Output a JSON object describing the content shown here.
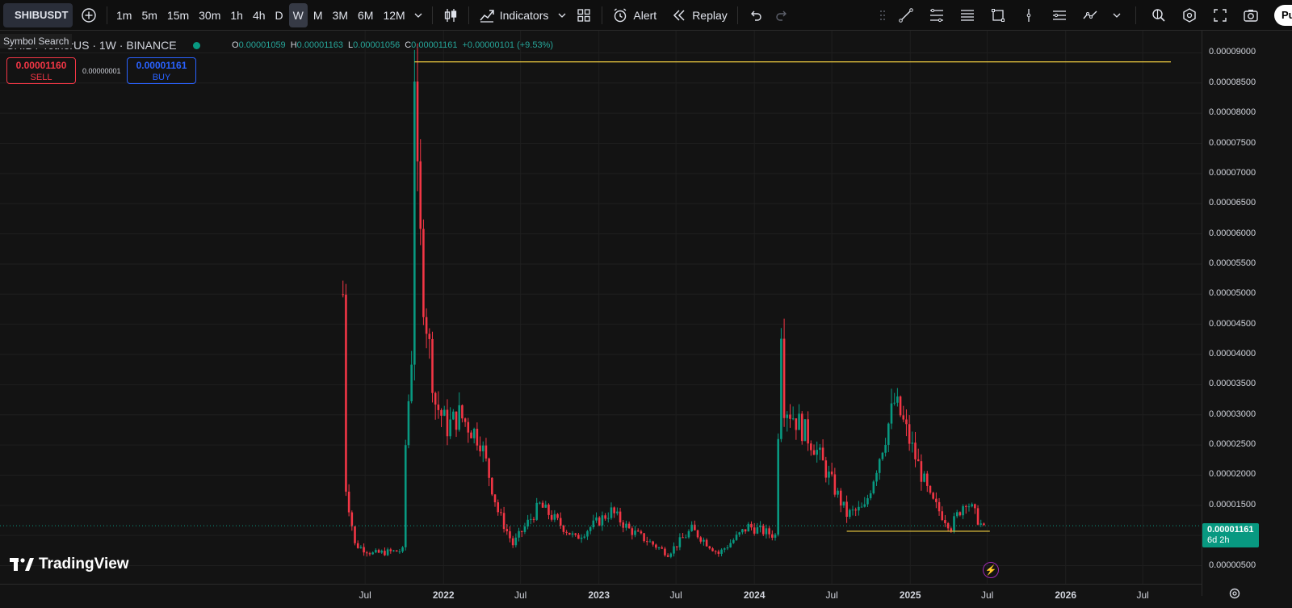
{
  "toolbar": {
    "symbol": "SHIBUSDT",
    "timeframes": [
      "1m",
      "5m",
      "15m",
      "30m",
      "1h",
      "4h",
      "D",
      "W",
      "M",
      "3M",
      "6M",
      "12M"
    ],
    "active_timeframe": "W",
    "indicators_label": "Indicators",
    "alert_label": "Alert",
    "replay_label": "Replay",
    "publish_label": "Pu"
  },
  "tooltip": "Symbol Search",
  "legend": {
    "title": "SHIB / TetherUS · 1W · BINANCE",
    "o_key": "O",
    "o_val": "0.00001059",
    "h_key": "H",
    "h_val": "0.00001163",
    "l_key": "L",
    "l_val": "0.00001056",
    "c_key": "C",
    "c_val": "0.00001161",
    "change": "+0.00000101 (+9.53%)"
  },
  "trade": {
    "sell_price": "0.00001160",
    "sell_label": "SELL",
    "spread": "0.00000001",
    "buy_price": "0.00001161",
    "buy_label": "BUY"
  },
  "price_axis": {
    "ticks": [
      "0.00009000",
      "0.00008500",
      "0.00008000",
      "0.00007500",
      "0.00007000",
      "0.00006500",
      "0.00006000",
      "0.00005500",
      "0.00005000",
      "0.00004500",
      "0.00004000",
      "0.00003500",
      "0.00003000",
      "0.00002500",
      "0.00002000",
      "0.00001500",
      "0.00001000",
      "0.00000500"
    ],
    "current_price": "0.00001161",
    "countdown": "6d 2h"
  },
  "time_axis": {
    "labels": [
      {
        "text": "Jul",
        "year": false
      },
      {
        "text": "2022",
        "year": true
      },
      {
        "text": "Jul",
        "year": false
      },
      {
        "text": "2023",
        "year": true
      },
      {
        "text": "Jul",
        "year": false
      },
      {
        "text": "2024",
        "year": true
      },
      {
        "text": "Jul",
        "year": false
      },
      {
        "text": "2025",
        "year": true
      },
      {
        "text": "Jul",
        "year": false
      },
      {
        "text": "2026",
        "year": true
      },
      {
        "text": "Jul",
        "year": false
      }
    ]
  },
  "logo_text": "TradingView",
  "colors": {
    "up": "#089981",
    "down": "#f23645",
    "hline": "#f5d142",
    "background": "#131313"
  },
  "chart_data": {
    "type": "candlestick",
    "symbol": "SHIBUSDT",
    "interval": "1W",
    "ylim": [
      4e-06,
      9.18e-05
    ],
    "x_range": [
      "2021-05",
      "2026-11"
    ],
    "horizontal_lines": [
      8.85e-05,
      1.07e-05
    ],
    "current_price": 1.161e-05,
    "path_points": [
      {
        "date": "2021-05-10",
        "value": 5e-05
      },
      {
        "date": "2021-05-17",
        "value": 1.8e-05
      },
      {
        "date": "2021-06-07",
        "value": 8.5e-06
      },
      {
        "date": "2021-07-19",
        "value": 7e-06
      },
      {
        "date": "2021-09-27",
        "value": 7.5e-06
      },
      {
        "date": "2021-10-04",
        "value": 2.5e-05
      },
      {
        "date": "2021-10-18",
        "value": 4e-05
      },
      {
        "date": "2021-10-25",
        "value": 8.85e-05
      },
      {
        "date": "2021-11-01",
        "value": 6.7e-05
      },
      {
        "date": "2021-11-15",
        "value": 5e-05
      },
      {
        "date": "2021-12-13",
        "value": 3.2e-05
      },
      {
        "date": "2022-01-10",
        "value": 2.8e-05
      },
      {
        "date": "2022-02-07",
        "value": 3e-05
      },
      {
        "date": "2022-03-28",
        "value": 2.6e-05
      },
      {
        "date": "2022-05-09",
        "value": 1.4e-05
      },
      {
        "date": "2022-06-13",
        "value": 8.5e-06
      },
      {
        "date": "2022-08-15",
        "value": 1.5e-05
      },
      {
        "date": "2022-11-07",
        "value": 9.5e-06
      },
      {
        "date": "2023-01-30",
        "value": 1.4e-05
      },
      {
        "date": "2023-03-13",
        "value": 1.1e-05
      },
      {
        "date": "2023-06-12",
        "value": 7e-06
      },
      {
        "date": "2023-08-07",
        "value": 1.1e-05
      },
      {
        "date": "2023-10-09",
        "value": 7e-06
      },
      {
        "date": "2023-12-18",
        "value": 1.15e-05
      },
      {
        "date": "2024-02-19",
        "value": 1e-05
      },
      {
        "date": "2024-03-04",
        "value": 4.56e-05
      },
      {
        "date": "2024-03-11",
        "value": 3.2e-05
      },
      {
        "date": "2024-05-20",
        "value": 2.5e-05
      },
      {
        "date": "2024-08-05",
        "value": 1.35e-05
      },
      {
        "date": "2024-09-16",
        "value": 1.45e-05
      },
      {
        "date": "2024-11-25",
        "value": 3.2e-05
      },
      {
        "date": "2024-12-09",
        "value": 3e-05
      },
      {
        "date": "2025-02-17",
        "value": 1.6e-05
      },
      {
        "date": "2025-04-07",
        "value": 1.15e-05
      },
      {
        "date": "2025-05-12",
        "value": 1.6e-05
      },
      {
        "date": "2025-06-23",
        "value": 1.1e-05
      }
    ]
  }
}
